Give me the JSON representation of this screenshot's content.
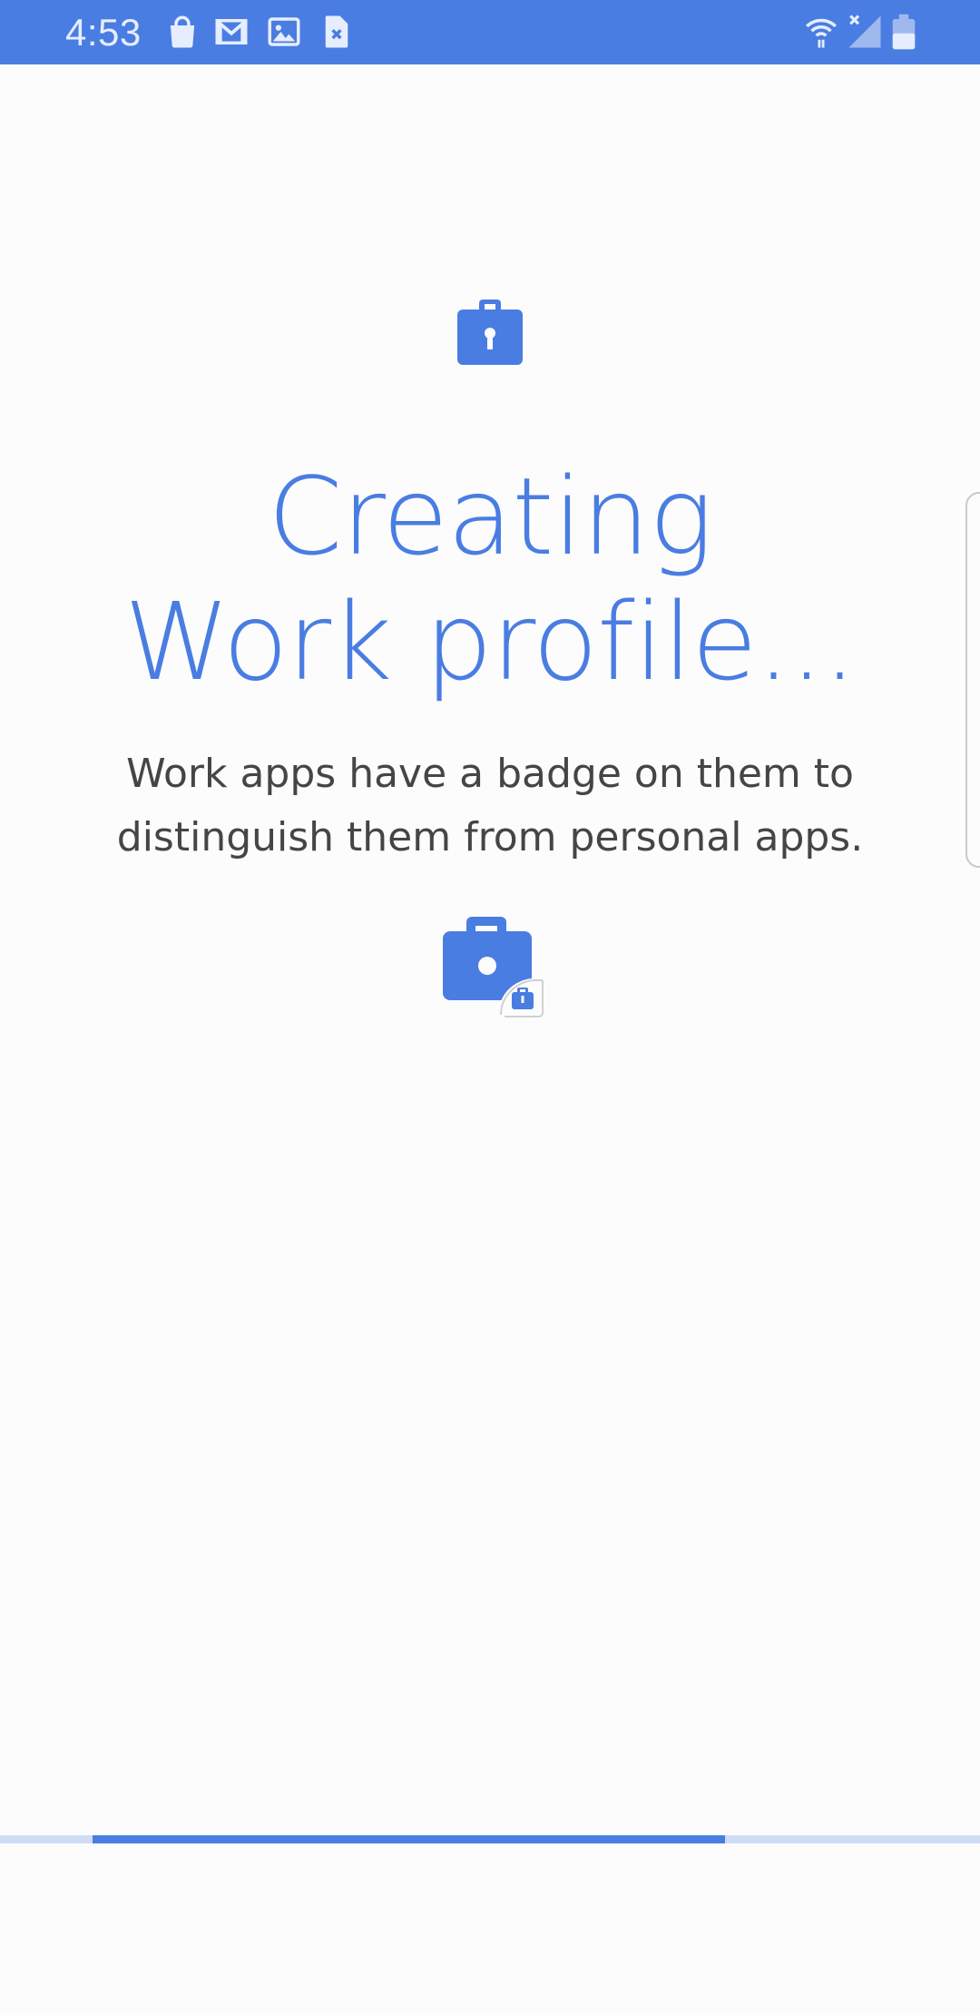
{
  "status_bar": {
    "time": "4:53",
    "background_color": "#4a7de2",
    "left_icons": [
      "shopping-bag-icon",
      "gmail-icon",
      "gallery-icon",
      "file-close-icon"
    ],
    "right_icons": [
      "wifi-icon",
      "signal-icon",
      "battery-icon"
    ]
  },
  "main": {
    "title_line1": "Creating",
    "title_line2": "Work profile...",
    "description": "Work apps have a badge on them to distinguish them from personal apps.",
    "accent_color": "#4a7de2",
    "hero_icon": "work-briefcase-lock-icon",
    "badge_icon": "work-app-badge-icon"
  },
  "progress": {
    "type": "indeterminate",
    "visible_segment_start": 0.094,
    "visible_segment_end": 0.74,
    "track_color": "#cfdcf6",
    "fill_color": "#4a7de2"
  }
}
